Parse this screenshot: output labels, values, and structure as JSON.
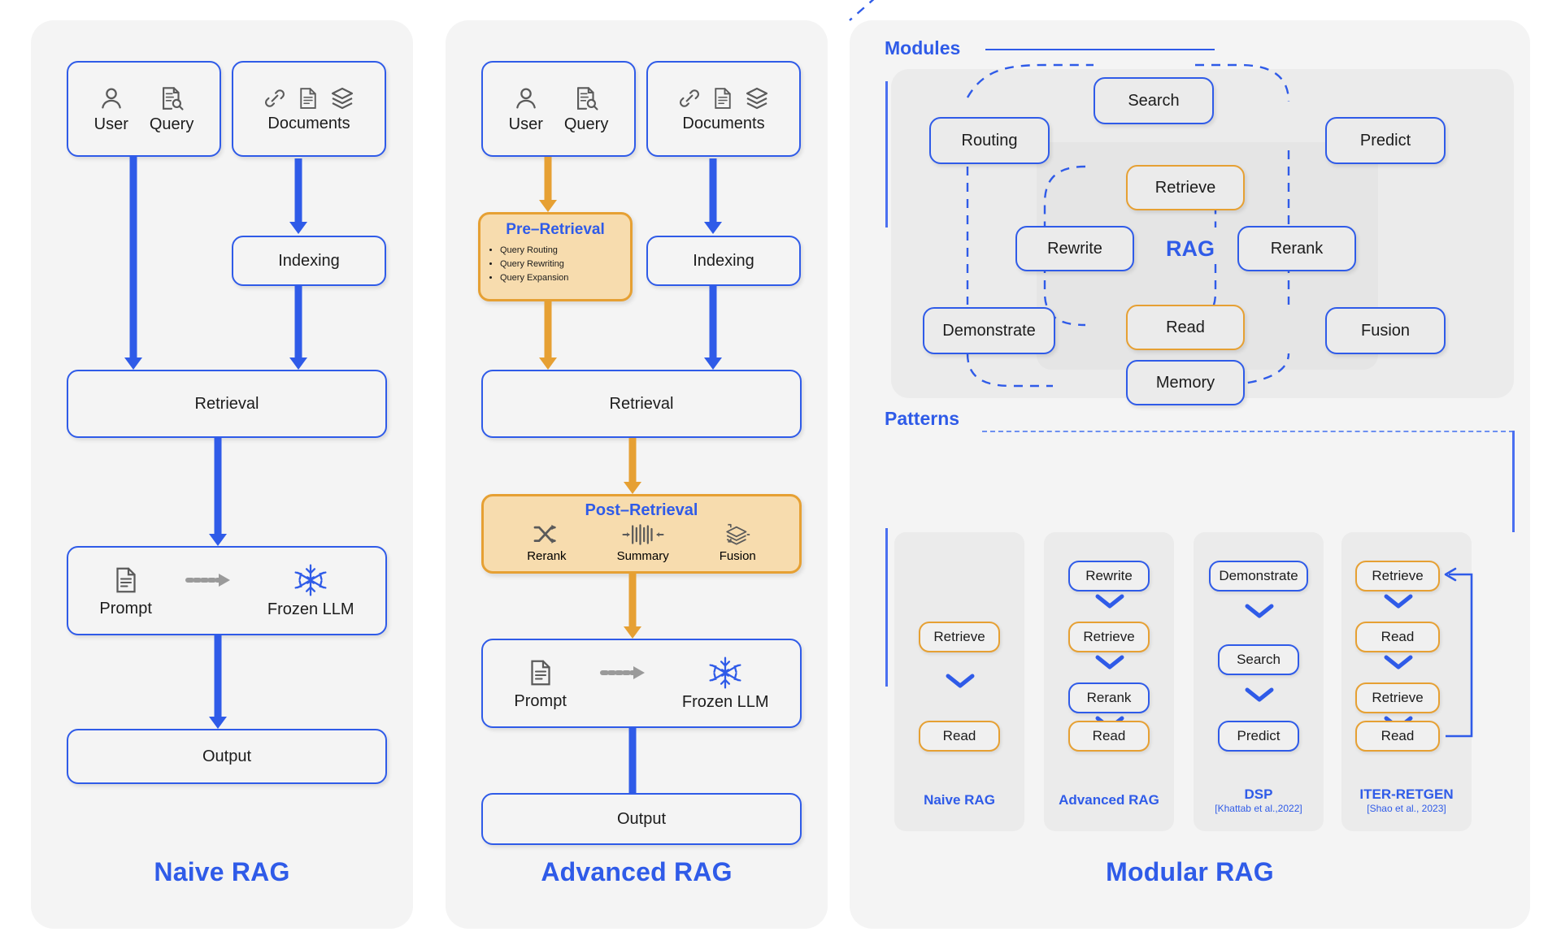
{
  "panels": {
    "naive": {
      "title": "Naive RAG",
      "nodes": {
        "user": "User",
        "query": "Query",
        "documents": "Documents",
        "indexing": "Indexing",
        "retrieval": "Retrieval",
        "prompt": "Prompt",
        "frozen_llm": "Frozen LLM",
        "output": "Output"
      },
      "icons": {
        "user": "user-icon",
        "query": "document-search-icon",
        "link": "link-icon",
        "doc": "document-icon",
        "layers": "layers-icon",
        "prompt": "document-icon",
        "frozen": "snowflake-icon",
        "arrow": "arrow-right-icon"
      }
    },
    "advanced": {
      "title": "Advanced RAG",
      "nodes": {
        "user": "User",
        "query": "Query",
        "documents": "Documents",
        "indexing": "Indexing",
        "retrieval": "Retrieval",
        "prompt": "Prompt",
        "frozen_llm": "Frozen LLM",
        "output": "Output"
      },
      "pre_retrieval": {
        "title": "Pre–Retrieval",
        "items": [
          "Query Routing",
          "Query Rewriting",
          "Query Expansion"
        ]
      },
      "post_retrieval": {
        "title": "Post–Retrieval",
        "items": [
          {
            "label": "Rerank",
            "icon": "shuffle-icon"
          },
          {
            "label": "Summary",
            "icon": "compress-icon"
          },
          {
            "label": "Fusion",
            "icon": "layers-merge-icon"
          }
        ]
      }
    },
    "modular": {
      "title": "Modular RAG",
      "modules_label": "Modules",
      "patterns_label": "Patterns",
      "center_label": "RAG",
      "modules": [
        {
          "name": "Routing",
          "color": "blue"
        },
        {
          "name": "Search",
          "color": "blue"
        },
        {
          "name": "Predict",
          "color": "blue"
        },
        {
          "name": "Retrieve",
          "color": "orange"
        },
        {
          "name": "Rewrite",
          "color": "blue"
        },
        {
          "name": "Rerank",
          "color": "blue"
        },
        {
          "name": "Read",
          "color": "orange"
        },
        {
          "name": "Demonstrate",
          "color": "blue"
        },
        {
          "name": "Fusion",
          "color": "blue"
        },
        {
          "name": "Memory",
          "color": "blue"
        }
      ],
      "patterns": [
        {
          "name": "Naive RAG",
          "cite": "",
          "steps": [
            {
              "label": "Retrieve",
              "color": "orange"
            },
            {
              "label": "Read",
              "color": "orange"
            }
          ]
        },
        {
          "name": "Advanced RAG",
          "cite": "",
          "steps": [
            {
              "label": "Rewrite",
              "color": "blue"
            },
            {
              "label": "Retrieve",
              "color": "orange"
            },
            {
              "label": "Rerank",
              "color": "blue"
            },
            {
              "label": "Read",
              "color": "orange"
            }
          ]
        },
        {
          "name": "DSP",
          "cite": "[Khattab et al.,2022]",
          "steps": [
            {
              "label": "Demonstrate",
              "color": "blue"
            },
            {
              "label": "Search",
              "color": "blue"
            },
            {
              "label": "Predict",
              "color": "blue"
            }
          ]
        },
        {
          "name": "ITER-RETGEN",
          "cite": "[Shao et al., 2023]",
          "steps": [
            {
              "label": "Retrieve",
              "color": "orange"
            },
            {
              "label": "Read",
              "color": "orange"
            },
            {
              "label": "Retrieve",
              "color": "orange"
            },
            {
              "label": "Read",
              "color": "orange"
            }
          ]
        }
      ]
    }
  },
  "colors": {
    "blue": "#2f5be8",
    "orange": "#e6a033",
    "orange_fill": "#f7dcae",
    "panel_bg": "#f4f4f4",
    "module_bg": "#ebebeb",
    "text": "#1c1c1c",
    "icon_gray": "#5a5a5a"
  }
}
